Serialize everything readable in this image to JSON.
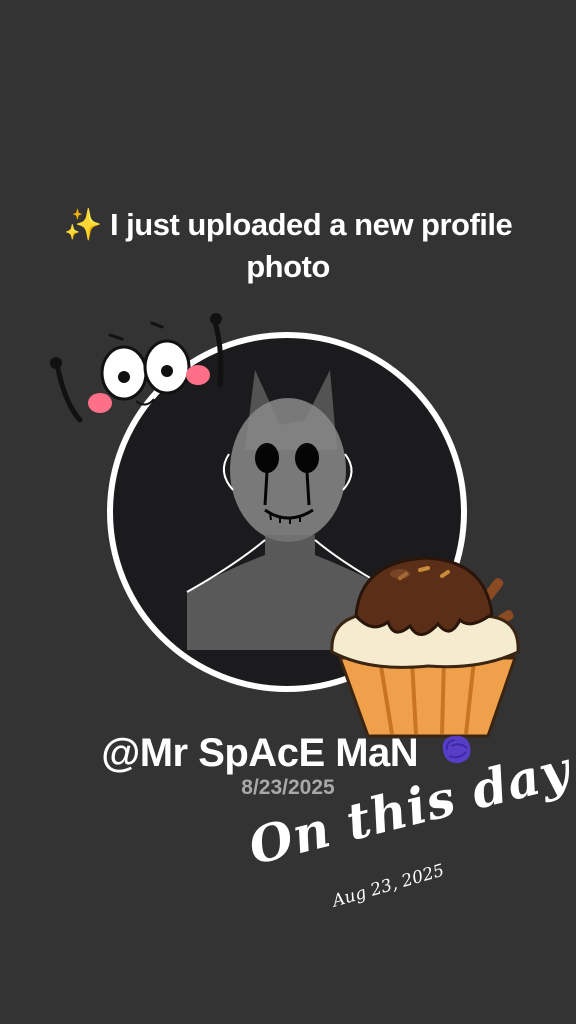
{
  "post": {
    "headline_icon": "✨",
    "headline_text": "I just uploaded a new profile photo",
    "username": "@Mr SpAcE MaN",
    "date": "8/23/2025"
  },
  "memory": {
    "title": "On this day",
    "date": "Aug 23, 2025"
  },
  "icons": {
    "sparkle": "sparkle-emoji",
    "badge": "purple-blob-icon",
    "sticker_1": "cartoon-eyes-sticker",
    "sticker_2": "cupcake-sticker"
  },
  "colors": {
    "background": "#333333",
    "text": "#ffffff",
    "date_text": "#a8a8a8",
    "avatar_ring": "#ffffff",
    "badge": "#5b3fd6"
  }
}
